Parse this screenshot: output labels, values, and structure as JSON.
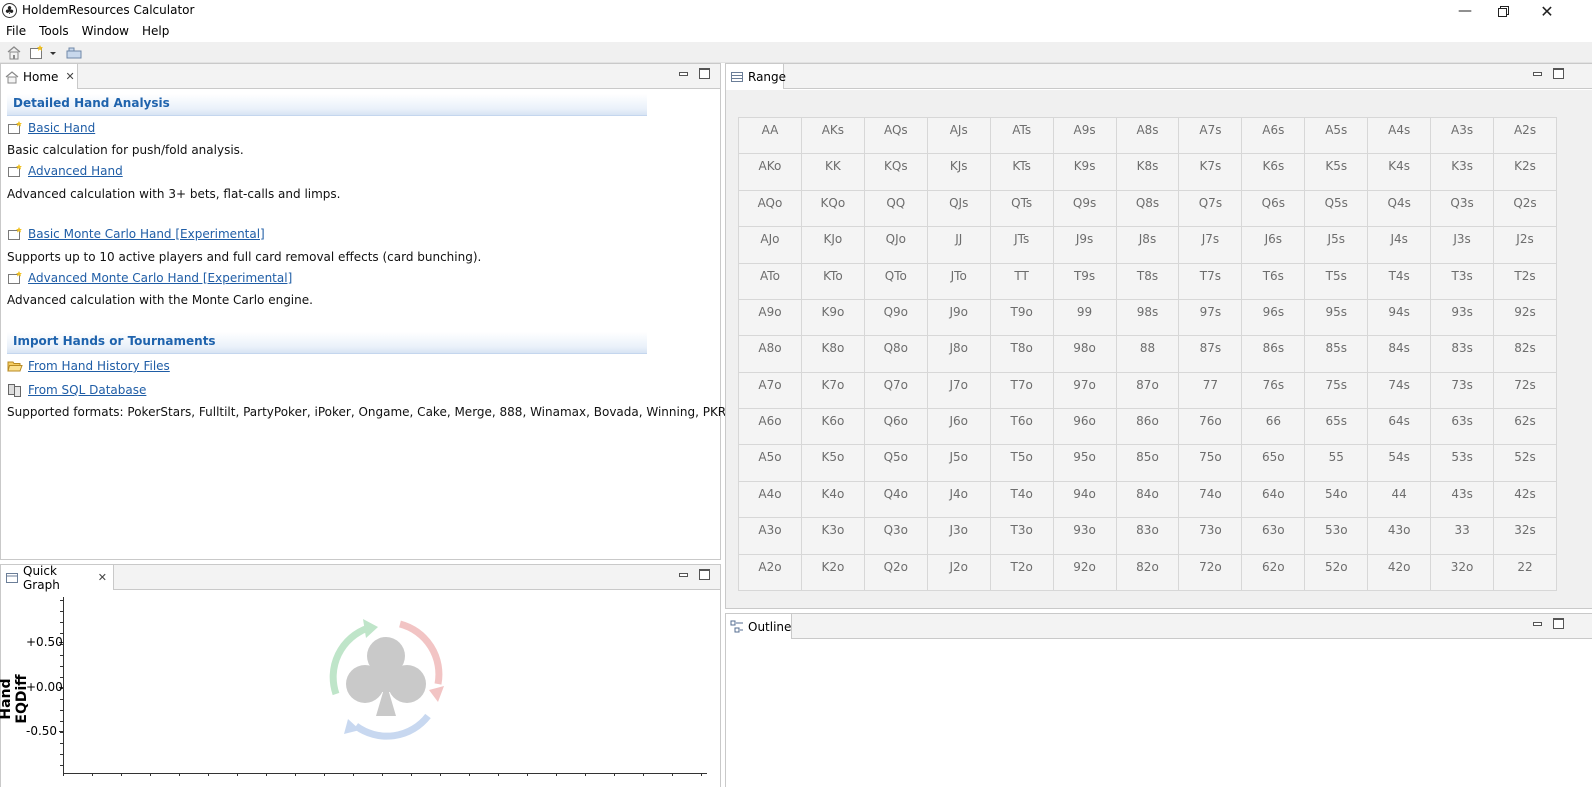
{
  "window": {
    "title": "HoldemResources Calculator"
  },
  "menu": [
    "File",
    "Tools",
    "Window",
    "Help"
  ],
  "home": {
    "tab_label": "Home",
    "sections": [
      {
        "header": "Detailed Hand Analysis"
      },
      {
        "header": "Import Hands or Tournaments"
      }
    ],
    "links": {
      "basic_hand": "Basic Hand",
      "basic_hand_desc": "Basic calculation for push/fold analysis.",
      "advanced_hand": "Advanced Hand",
      "advanced_hand_desc": "Advanced calculation with 3+ bets, flat-calls and limps.",
      "basic_mc": "Basic Monte Carlo Hand [Experimental]",
      "basic_mc_desc": "Supports up to 10 active players and full card removal effects (card bunching).",
      "advanced_mc": "Advanced Monte Carlo Hand [Experimental]",
      "advanced_mc_desc": "Advanced calculation with the Monte Carlo engine.",
      "from_hh": "From Hand History Files",
      "from_sql": "From SQL Database",
      "formats": "Supported formats: PokerStars, Fulltilt, PartyPoker, iPoker, Ongame, Cake, Merge, 888, Winamax, Bovada, Winning, PKR, GG"
    }
  },
  "range": {
    "tab_label": "Range",
    "grid": [
      [
        "AA",
        "AKs",
        "AQs",
        "AJs",
        "ATs",
        "A9s",
        "A8s",
        "A7s",
        "A6s",
        "A5s",
        "A4s",
        "A3s",
        "A2s"
      ],
      [
        "AKo",
        "KK",
        "KQs",
        "KJs",
        "KTs",
        "K9s",
        "K8s",
        "K7s",
        "K6s",
        "K5s",
        "K4s",
        "K3s",
        "K2s"
      ],
      [
        "AQo",
        "KQo",
        "QQ",
        "QJs",
        "QTs",
        "Q9s",
        "Q8s",
        "Q7s",
        "Q6s",
        "Q5s",
        "Q4s",
        "Q3s",
        "Q2s"
      ],
      [
        "AJo",
        "KJo",
        "QJo",
        "JJ",
        "JTs",
        "J9s",
        "J8s",
        "J7s",
        "J6s",
        "J5s",
        "J4s",
        "J3s",
        "J2s"
      ],
      [
        "ATo",
        "KTo",
        "QTo",
        "JTo",
        "TT",
        "T9s",
        "T8s",
        "T7s",
        "T6s",
        "T5s",
        "T4s",
        "T3s",
        "T2s"
      ],
      [
        "A9o",
        "K9o",
        "Q9o",
        "J9o",
        "T9o",
        "99",
        "98s",
        "97s",
        "96s",
        "95s",
        "94s",
        "93s",
        "92s"
      ],
      [
        "A8o",
        "K8o",
        "Q8o",
        "J8o",
        "T8o",
        "98o",
        "88",
        "87s",
        "86s",
        "85s",
        "84s",
        "83s",
        "82s"
      ],
      [
        "A7o",
        "K7o",
        "Q7o",
        "J7o",
        "T7o",
        "97o",
        "87o",
        "77",
        "76s",
        "75s",
        "74s",
        "73s",
        "72s"
      ],
      [
        "A6o",
        "K6o",
        "Q6o",
        "J6o",
        "T6o",
        "96o",
        "86o",
        "76o",
        "66",
        "65s",
        "64s",
        "63s",
        "62s"
      ],
      [
        "A5o",
        "K5o",
        "Q5o",
        "J5o",
        "T5o",
        "95o",
        "85o",
        "75o",
        "65o",
        "55",
        "54s",
        "53s",
        "52s"
      ],
      [
        "A4o",
        "K4o",
        "Q4o",
        "J4o",
        "T4o",
        "94o",
        "84o",
        "74o",
        "64o",
        "54o",
        "44",
        "43s",
        "42s"
      ],
      [
        "A3o",
        "K3o",
        "Q3o",
        "J3o",
        "T3o",
        "93o",
        "83o",
        "73o",
        "63o",
        "53o",
        "43o",
        "33",
        "32s"
      ],
      [
        "A2o",
        "K2o",
        "Q2o",
        "J2o",
        "T2o",
        "92o",
        "82o",
        "72o",
        "62o",
        "52o",
        "42o",
        "32o",
        "22"
      ]
    ]
  },
  "quick_graph": {
    "tab_label": "Quick Graph",
    "y_title": "Hand EQDiff",
    "y_labels": [
      "+0.50",
      "+0.00",
      "-0.50"
    ]
  },
  "outline": {
    "tab_label": "Outline"
  },
  "colors": {
    "link": "#1f5da6",
    "section_header": "#1f63ad"
  }
}
